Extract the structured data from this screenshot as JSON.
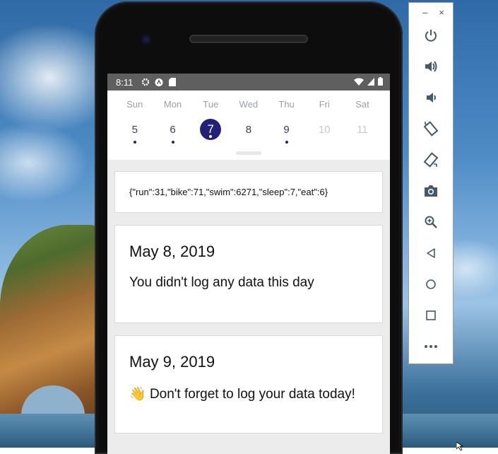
{
  "status": {
    "time": "8:11",
    "icons": [
      "gear-icon",
      "android-icon",
      "sd-card-icon",
      "wifi-icon",
      "signal-icon",
      "battery-icon"
    ]
  },
  "week": {
    "days": [
      {
        "name": "Sun",
        "num": "5",
        "dot": true,
        "state": "normal"
      },
      {
        "name": "Mon",
        "num": "6",
        "dot": true,
        "state": "normal"
      },
      {
        "name": "Tue",
        "num": "7",
        "dot": true,
        "state": "selected"
      },
      {
        "name": "Wed",
        "num": "8",
        "dot": false,
        "state": "normal"
      },
      {
        "name": "Thu",
        "num": "9",
        "dot": true,
        "state": "normal"
      },
      {
        "name": "Fri",
        "num": "10",
        "dot": false,
        "state": "dim"
      },
      {
        "name": "Sat",
        "num": "11",
        "dot": false,
        "state": "dim"
      }
    ],
    "selected_color": "#232079"
  },
  "cards": {
    "json_text": "{\"run\":31,\"bike\":71,\"swim\":6271,\"sleep\":7,\"eat\":6}",
    "day1": {
      "title": "May 8, 2019",
      "message": "You didn't log any data this day"
    },
    "day2": {
      "title": "May 9, 2019",
      "emoji": "👋",
      "message": "Don't forget to log your data today!"
    }
  },
  "emulator_toolbar": {
    "window_controls": {
      "minimize": "–",
      "close": "×"
    },
    "buttons": [
      "power-icon",
      "volume-up-icon",
      "volume-down-icon",
      "rotate-left-icon",
      "rotate-right-icon",
      "screenshot-icon",
      "zoom-icon",
      "back-icon",
      "home-icon",
      "overview-icon",
      "more-icon"
    ]
  }
}
